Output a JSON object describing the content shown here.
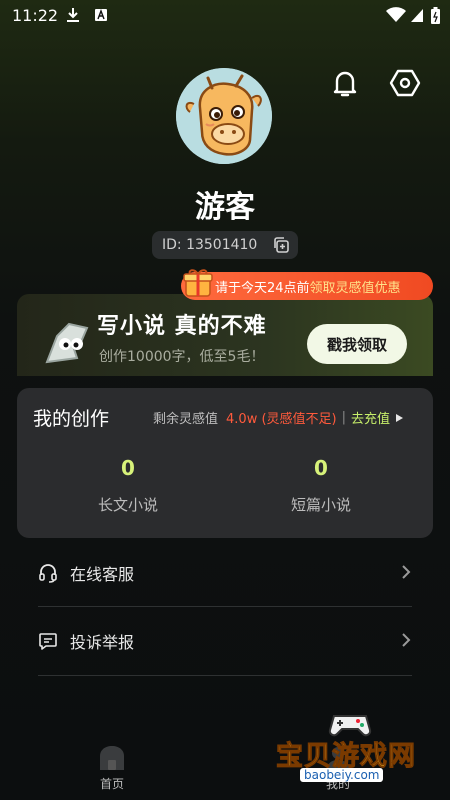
{
  "status_bar": {
    "time": "11:22"
  },
  "profile": {
    "name": "游客",
    "id_text": "ID: 13501410"
  },
  "promo_tip": {
    "text_pre": "请于今天24点前",
    "text_highlight": "领取灵感值优惠"
  },
  "banner": {
    "title": "写小说 真的不难",
    "subtitle": "创作10000字，低至5毛！",
    "button": "戳我领取"
  },
  "creation_card": {
    "title": "我的创作",
    "inspiration_label": "剩余灵感值",
    "inspiration_value": "4.0w (灵感值不足)",
    "separator": "|",
    "recharge": "去充值",
    "stats": [
      {
        "value": "0",
        "label": "长文小说"
      },
      {
        "value": "0",
        "label": "短篇小说"
      }
    ]
  },
  "menu": [
    {
      "label": "在线客服",
      "icon": "headset-icon"
    },
    {
      "label": "投诉举报",
      "icon": "report-icon"
    }
  ],
  "tabbar": [
    {
      "label": "首页",
      "icon": "home-icon"
    },
    {
      "label": "我的",
      "icon": "user-icon"
    }
  ],
  "watermark": {
    "text": "宝贝游戏网",
    "url": "baobeiy.com"
  },
  "colors": {
    "accent_green": "#c7ef6a",
    "alert_orange": "#f04a22",
    "card_bg": "#2b2c2e"
  }
}
